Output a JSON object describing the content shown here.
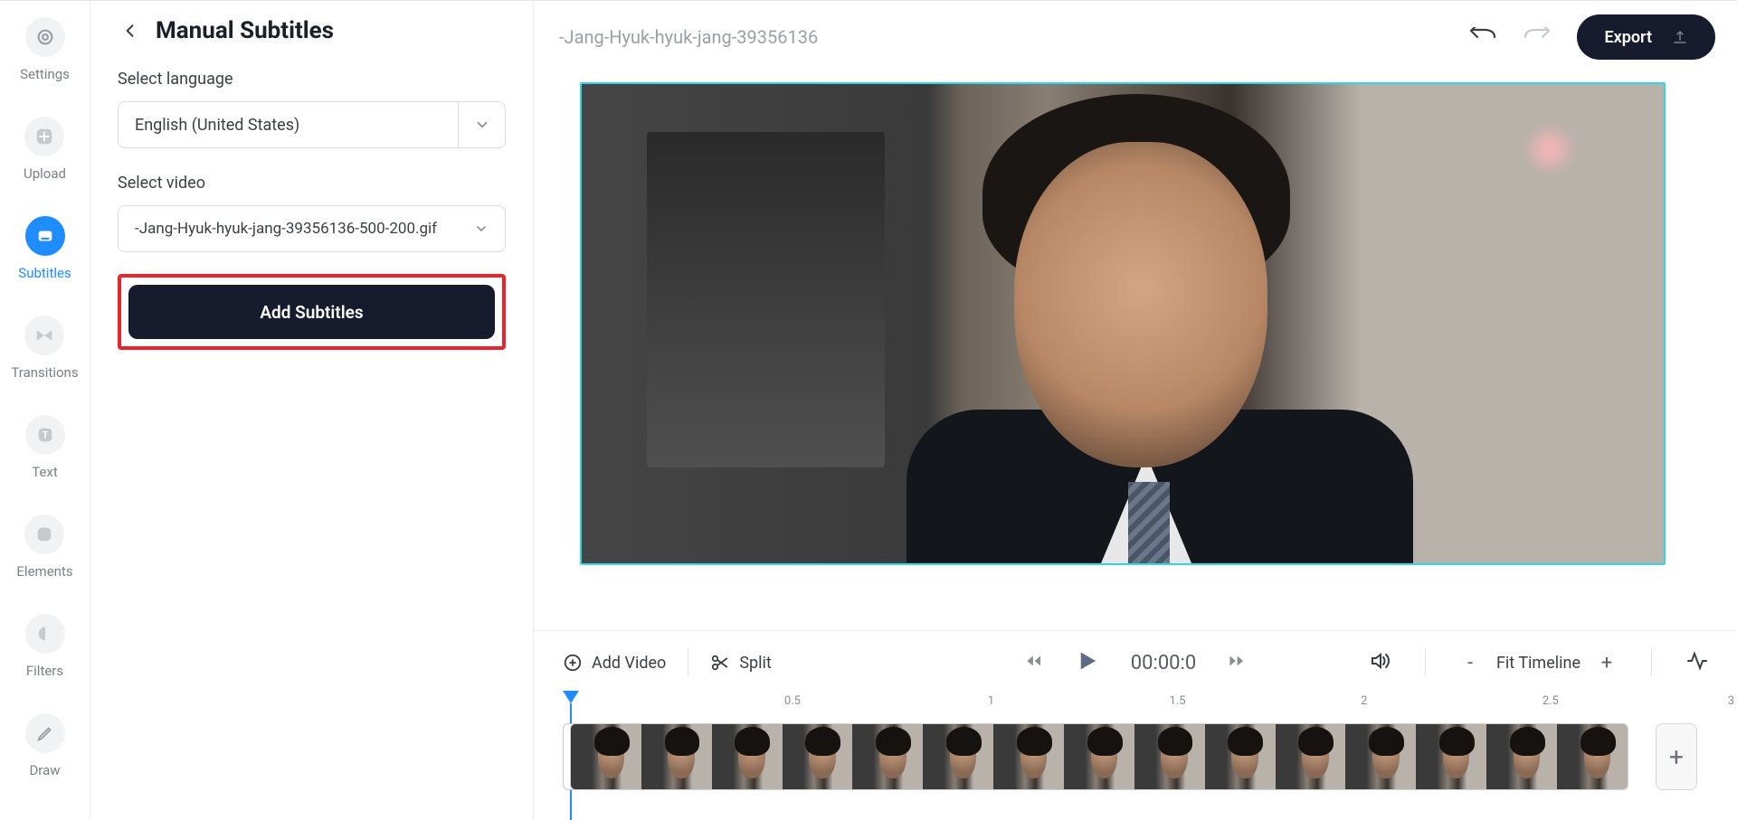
{
  "sidebar": {
    "items": [
      {
        "label": "Settings",
        "icon": "gear"
      },
      {
        "label": "Upload",
        "icon": "plus"
      },
      {
        "label": "Subtitles",
        "icon": "subtitle"
      },
      {
        "label": "Transitions",
        "icon": "transition"
      },
      {
        "label": "Text",
        "icon": "text"
      },
      {
        "label": "Elements",
        "icon": "elements"
      },
      {
        "label": "Filters",
        "icon": "contrast"
      },
      {
        "label": "Draw",
        "icon": "pencil"
      }
    ],
    "active_index": 2
  },
  "panel": {
    "title": "Manual Subtitles",
    "select_language_label": "Select language",
    "language_value": "English (United States)",
    "select_video_label": "Select video",
    "video_value": "-Jang-Hyuk-hyuk-jang-39356136-500-200.gif",
    "add_button": "Add Subtitles"
  },
  "topbar": {
    "filename": "-Jang-Hyuk-hyuk-jang-39356136",
    "export_label": "Export"
  },
  "timeline": {
    "add_video_label": "Add Video",
    "split_label": "Split",
    "time_display": "00:00:0",
    "fit_label": "Fit Timeline",
    "ticks": [
      "0.5",
      "1",
      "1.5",
      "2",
      "2.5",
      "3"
    ]
  }
}
